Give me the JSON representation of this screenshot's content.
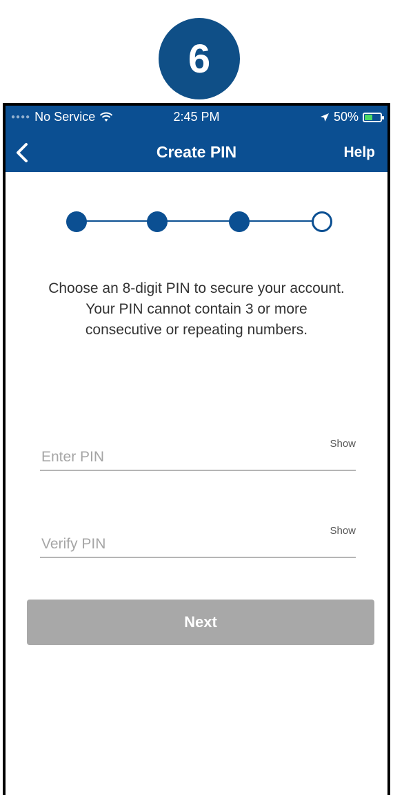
{
  "step_badge": "6",
  "status_bar": {
    "carrier": "No Service",
    "time": "2:45 PM",
    "battery": "50%",
    "battery_level": 0.5
  },
  "nav": {
    "title": "Create PIN",
    "help_label": "Help"
  },
  "progress": {
    "total_steps": 4,
    "completed_steps": 3
  },
  "instructions": "Choose an 8-digit PIN to secure your account. Your PIN cannot contain 3 or more consecutive or repeating numbers.",
  "form": {
    "enter_pin": {
      "placeholder": "Enter PIN",
      "value": "",
      "show_label": "Show"
    },
    "verify_pin": {
      "placeholder": "Verify PIN",
      "value": "",
      "show_label": "Show"
    }
  },
  "next_button": {
    "label": "Next",
    "enabled": false
  },
  "colors": {
    "brand_blue": "#0b4f92",
    "badge_blue": "#0f4f87",
    "disabled_button": "#a8a8a8"
  }
}
